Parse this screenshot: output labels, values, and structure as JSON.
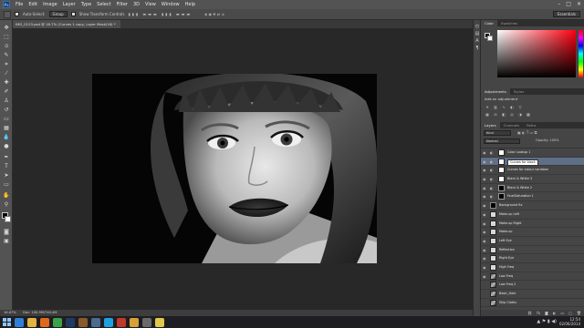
{
  "menubar": {
    "logo": "Ps",
    "items": [
      "File",
      "Edit",
      "Image",
      "Layer",
      "Type",
      "Select",
      "Filter",
      "3D",
      "View",
      "Window",
      "Help"
    ],
    "window_controls": [
      "–",
      "□",
      "✕"
    ]
  },
  "options": {
    "auto_select_label": "Auto-Select:",
    "group_value": "Group",
    "transform_label": "Show Transform Controls",
    "workspace_value": "Essentials"
  },
  "document": {
    "tab_title": "IMG_0123.psd @ 16.7% (Curves 1 copy, Layer Mask/16) *"
  },
  "statusbar": {
    "zoom": "16.67%",
    "doc_info": "Doc: 100.9M/740.4M"
  },
  "panels": {
    "color_tabs": [
      "Color",
      "Swatches"
    ],
    "adjust_tabs": [
      "Adjustments",
      "Styles"
    ],
    "adjust_title": "Add an adjustment",
    "layers_tabs": [
      "Layers",
      "Channels",
      "Paths"
    ],
    "layers_kind": "Kind",
    "blend_mode": "Normal",
    "opacity_label": "Opacity: 100%",
    "fill_label": "Fill: 100%"
  },
  "layers": [
    {
      "name": "Color Lookup 1",
      "visible": true,
      "type": "adjustment",
      "mask": "white",
      "selected": false
    },
    {
      "name": "Curves for black",
      "visible": true,
      "type": "adjustment",
      "mask": "white",
      "selected": true
    },
    {
      "name": "Curves for colour variation",
      "visible": true,
      "type": "adjustment",
      "mask": "white",
      "selected": false
    },
    {
      "name": "Black & White 3",
      "visible": true,
      "type": "adjustment",
      "mask": "white",
      "selected": false
    },
    {
      "name": "Black & White 2",
      "visible": true,
      "type": "adjustment",
      "mask": "black",
      "selected": false
    },
    {
      "name": "Hue/Saturation 1",
      "visible": true,
      "type": "adjustment",
      "mask": "black",
      "selected": false
    },
    {
      "name": "Background fix",
      "visible": true,
      "type": "pixel",
      "thumb": "black",
      "selected": false
    },
    {
      "name": "Make-up Left",
      "visible": true,
      "type": "pixel",
      "thumb": "white",
      "selected": false
    },
    {
      "name": "Make-up Right",
      "visible": true,
      "type": "pixel",
      "thumb": "white",
      "selected": false
    },
    {
      "name": "Make-up",
      "visible": true,
      "type": "pixel",
      "thumb": "white",
      "selected": false
    },
    {
      "name": "Left Eye",
      "visible": true,
      "type": "pixel",
      "thumb": "white",
      "selected": false
    },
    {
      "name": "Reflection",
      "visible": true,
      "type": "pixel",
      "thumb": "white",
      "selected": false
    },
    {
      "name": "Right Eye",
      "visible": true,
      "type": "pixel",
      "thumb": "white",
      "selected": false
    },
    {
      "name": "High Freq",
      "visible": true,
      "type": "pixel",
      "thumb": "white",
      "selected": false
    },
    {
      "name": "Low Freq",
      "visible": true,
      "type": "pixel",
      "thumb": "photo",
      "selected": false
    },
    {
      "name": "Low Freq 2",
      "visible": false,
      "type": "pixel",
      "thumb": "photo",
      "selected": false
    },
    {
      "name": "Basic_Hole",
      "visible": false,
      "type": "pixel",
      "thumb": "photo",
      "selected": false
    },
    {
      "name": "Skip Cloths",
      "visible": false,
      "type": "pixel",
      "thumb": "photo",
      "selected": false
    }
  ],
  "taskbar": {
    "time": "12:54",
    "date": "02/06/2014",
    "apps": [
      {
        "icon": "ie",
        "color": "#2f7fd8"
      },
      {
        "icon": "explorer",
        "color": "#e3b441"
      },
      {
        "icon": "media",
        "color": "#e06a1b"
      },
      {
        "icon": "chrome",
        "color": "#3aa34a"
      },
      {
        "icon": "photoshop",
        "color": "#1f3b64"
      },
      {
        "icon": "bridge",
        "color": "#8a5a2b"
      },
      {
        "icon": "lightroom",
        "color": "#4b6b8f"
      },
      {
        "icon": "skype",
        "color": "#1ea0e0"
      },
      {
        "icon": "mail",
        "color": "#c0392b"
      },
      {
        "icon": "folder",
        "color": "#d9a03a"
      },
      {
        "icon": "calc",
        "color": "#6a6a6a"
      },
      {
        "icon": "notes",
        "color": "#e2c84a"
      }
    ]
  }
}
